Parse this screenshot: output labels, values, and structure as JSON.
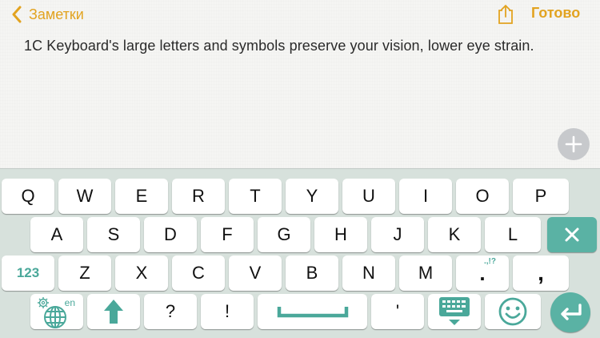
{
  "nav": {
    "back_label": "Заметки",
    "done_label": "Готово"
  },
  "note": {
    "text": "1C Keyboard's large letters and symbols preserve your vision, lower eye strain."
  },
  "colors": {
    "accent": "#e2a320",
    "teal": "#4aa89a",
    "keyboard_bg": "#d7e1dc"
  },
  "keyboard": {
    "row1": [
      "Q",
      "W",
      "E",
      "R",
      "T",
      "Y",
      "U",
      "I",
      "O",
      "P"
    ],
    "row2": [
      "A",
      "S",
      "D",
      "F",
      "G",
      "H",
      "J",
      "K",
      "L"
    ],
    "row3": {
      "numbers_label": "123",
      "letters": [
        "Z",
        "X",
        "C",
        "V",
        "B",
        "N",
        "M"
      ],
      "period": ".",
      "period_hint": ".,!?",
      "comma": ","
    },
    "row4": {
      "lang_label": "en",
      "question": "?",
      "exclaim": "!",
      "apostrophe": "'"
    },
    "icons": [
      "back-chevron-icon",
      "share-icon",
      "plus-icon",
      "delete-icon",
      "gear-icon",
      "globe-icon",
      "shift-arrow-icon",
      "space-bracket-icon",
      "keyboard-hide-icon",
      "smiley-icon",
      "return-arrow-icon"
    ]
  }
}
